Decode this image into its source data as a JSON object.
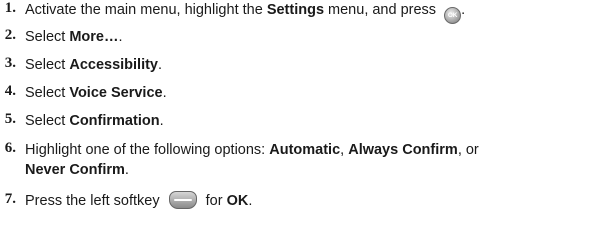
{
  "steps": [
    {
      "num": "1.",
      "before": "Activate the main menu, highlight the ",
      "bold": "Settings",
      "after": " menu, and press ",
      "icon": "ok-key-icon",
      "icon_text": "OK",
      "end": "."
    },
    {
      "num": "2.",
      "before": "Select ",
      "bold": "More…",
      "after": "."
    },
    {
      "num": "3.",
      "before": "Select ",
      "bold": "Accessibility",
      "after": "."
    },
    {
      "num": "4.",
      "before": "Select ",
      "bold": "Voice Service",
      "after": "."
    },
    {
      "num": "5.",
      "before": "Select ",
      "bold": "Confirmation",
      "after": "."
    },
    {
      "num": "6.",
      "before": "Highlight one of the following options: ",
      "bold1": "Automatic",
      "sep1": ", ",
      "bold2": "Always Confirm",
      "sep2": ", or",
      "bold3": "Never Confirm",
      "end": "."
    },
    {
      "num": "7.",
      "before": "Press the left softkey ",
      "icon": "left-softkey-icon",
      "mid": " for ",
      "bold": "OK",
      "end": "."
    }
  ]
}
